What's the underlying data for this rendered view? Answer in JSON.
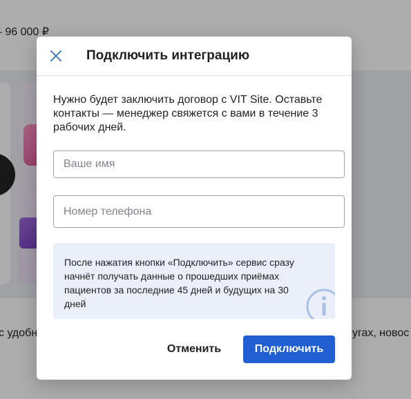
{
  "background": {
    "price_text": "– 96 000 ₽",
    "bottom_text_left": "с удобн",
    "bottom_text_right": "угах, новос"
  },
  "modal": {
    "title": "Подключить интеграцию",
    "close_icon": "close-icon",
    "description": "Нужно будет заключить договор с VIT Site. Оставьте контакты — менеджер свяжется с вами в течение 3 рабочих дней.",
    "name_placeholder": "Ваше имя",
    "phone_placeholder": "Номер телефона",
    "info_text": "После нажатия кнопки «Подключить» сервис сразу начнёт получать данные о прошедших приёмах пациентов за последние 45 дней и будущих на 30 дней",
    "info_icon": "info-icon",
    "cancel_label": "Отменить",
    "connect_label": "Подключить"
  },
  "colors": {
    "primary": "#1f5fd1",
    "info_background": "#eaeffa",
    "overlay": "rgba(0,0,0,0.32)",
    "close_icon": "#4a7fb8",
    "info_icon": "#a9c0e4"
  }
}
